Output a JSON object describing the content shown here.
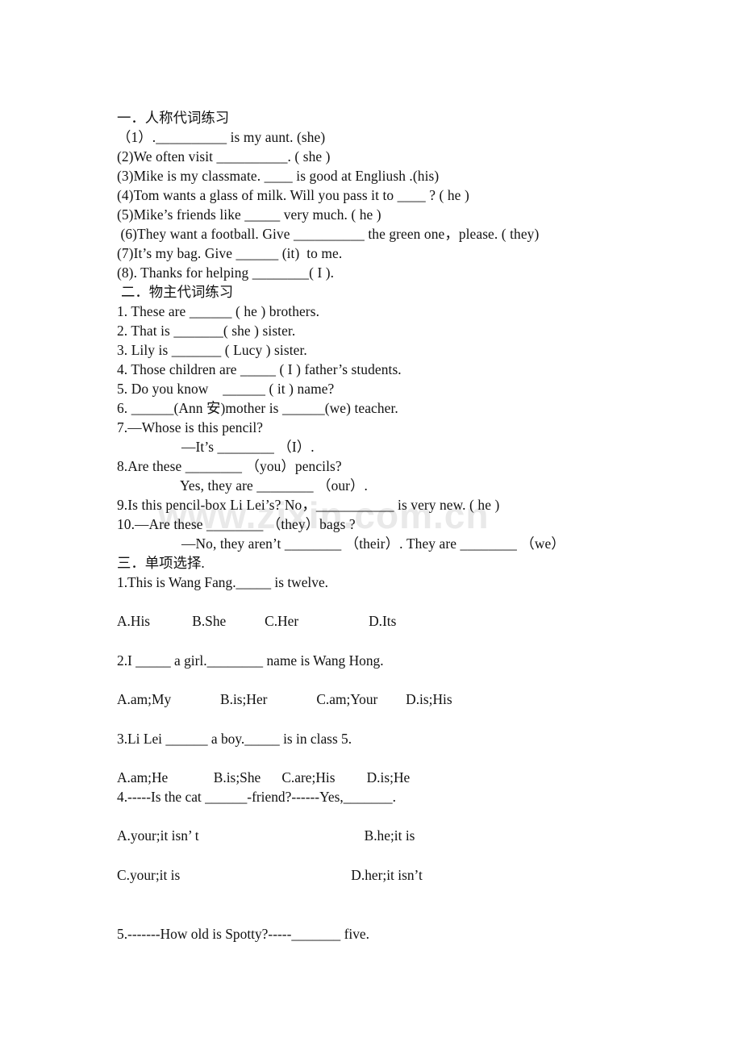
{
  "document": {
    "watermark": "www.zixin.com.cn"
  },
  "section_one": {
    "heading": "一．人称代词练习",
    "items": [
      "（1）.__________ is my aunt. (she)",
      "(2)We often visit __________. ( she )",
      "(3)Mike is my classmate. ____ is good at Engliush .(his)",
      "(4)Tom wants a glass of milk. Will you pass it to ____ ? ( he )",
      "(5)Mike’s friends like _____ very much. ( he )",
      " (6)They want a football. Give __________ the green one，please. ( they)",
      "(7)It’s my bag. Give ______ (it)  to me.",
      "(8). Thanks for helping ________( I )."
    ]
  },
  "section_two": {
    "heading": "二．物主代词练习",
    "items": [
      "1. These are ______ ( he ) brothers.",
      "2. That is _______( she ) sister.",
      "3. Lily is _______ ( Lucy ) sister.",
      "4. Those children are _____ ( I ) father’s students.",
      "5. Do you know    ______ ( it ) name?",
      "6. ______(Ann 安)mother is ______(we) teacher.",
      "7.—Whose is this pencil?",
      "—It’s ________ （I）.",
      "8.Are these ________ （you）pencils?",
      "Yes, they are ________ （our）.",
      "9.Is this pencil-box Li Lei’s? No，___________ is very new. ( he )",
      "10.—Are these ________ （they）bags ?",
      "—No, they aren’t ________ （their）. They are ________ （we）"
    ]
  },
  "section_three": {
    "heading": "三．单项选择.",
    "questions": [
      {
        "prompt": "1.This is Wang Fang._____ is twelve.",
        "choices": "A.His            B.She           C.Her                    D.Its"
      },
      {
        "prompt": "2.I _____ a girl.________ name is Wang Hong.",
        "choices": "A.am;My              B.is;Her              C.am;Your        D.is;His"
      },
      {
        "prompt": "3.Li Lei ______ a boy._____ is in class 5.",
        "choices": "A.am;He             B.is;She      C.are;His         D.is;He"
      },
      {
        "prompt": "4.-----Is the cat ______-friend?------Yes,_______.",
        "choices_a": "A.your;it isn’ t",
        "choices_b": "B.he;it is",
        "choices_c": "C.your;it is",
        "choices_d": "D.her;it isn’t"
      },
      {
        "prompt": "5.-------How old is Spotty?-----_______ five."
      }
    ]
  }
}
